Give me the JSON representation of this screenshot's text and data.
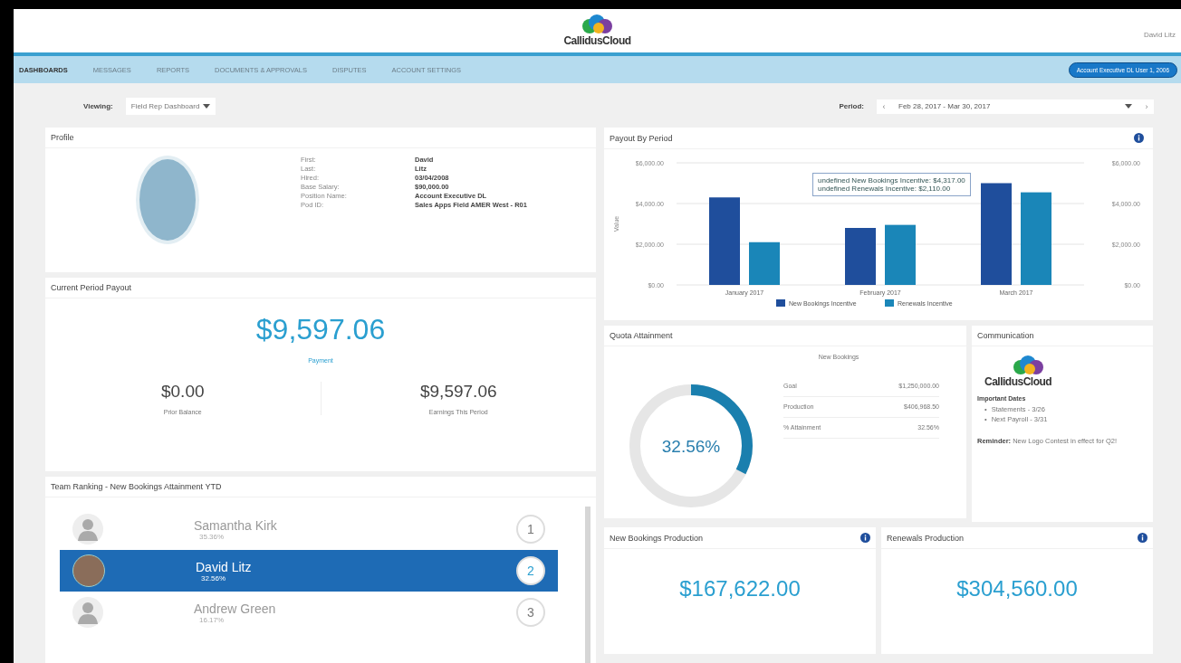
{
  "header": {
    "logo": "CallidusCloud",
    "user": "David Litz"
  },
  "nav": {
    "tabs": [
      {
        "label": "DASHBOARDS",
        "selected": true
      },
      {
        "label": "MESSAGES",
        "selected": false
      },
      {
        "label": "REPORTS",
        "selected": false
      },
      {
        "label": "DOCUMENTS & APPROVALS",
        "selected": false
      },
      {
        "label": "DISPUTES",
        "selected": false
      },
      {
        "label": "ACCOUNT SETTINGS",
        "selected": false
      }
    ],
    "badge": "Account Executive DL User 1, 2006"
  },
  "toolbar": {
    "viewing_label": "Viewing:",
    "viewing_value": "Field Rep Dashboard",
    "period_label": "Period:",
    "period_prev": "‹",
    "period_value": "Feb 28, 2017 - Mar 30, 2017",
    "period_next": "›"
  },
  "profile": {
    "title": "Profile",
    "fields": [
      {
        "label": "First:",
        "value": "David"
      },
      {
        "label": "Last:",
        "value": "Litz"
      },
      {
        "label": "Hired:",
        "value": "03/04/2008"
      },
      {
        "label": "Base Salary:",
        "value": "$90,000.00"
      },
      {
        "label": "Position Name:",
        "value": "Account Executive DL"
      },
      {
        "label": "Pod ID:",
        "value": "Sales Apps Field AMER West - R01"
      }
    ]
  },
  "current_payout": {
    "title": "Current Period Payout",
    "amount": "$9,597.06",
    "amount_label": "Payment",
    "items": [
      {
        "amount": "$0.00",
        "label": "Prior Balance"
      },
      {
        "amount": "$9,597.06",
        "label": "Earnings This Period"
      }
    ]
  },
  "team_ranking": {
    "title": "Team Ranking - New Bookings Attainment YTD",
    "rows": [
      {
        "name": "Samantha Kirk",
        "percent": "35.36%",
        "rank": "1",
        "selected": false,
        "kind": "generic"
      },
      {
        "name": "David Litz",
        "percent": "32.56%",
        "rank": "2",
        "selected": true,
        "kind": "photo"
      },
      {
        "name": "Andrew Green",
        "percent": "16.17%",
        "rank": "3",
        "selected": false,
        "kind": "generic"
      }
    ]
  },
  "payout_by_period": {
    "title": "Payout By Period",
    "right_ticks": [
      "$6,000.00",
      "$4,000.00",
      "$2,000.00",
      "$0.00"
    ],
    "tooltip": [
      "undefined New Bookings Incentive: $4,317.00",
      "undefined Renewals Incentive: $2,110.00"
    ],
    "chart_data": {
      "type": "bar",
      "ylabel": "Value",
      "categories": [
        "January 2017",
        "February 2017",
        "March 2017"
      ],
      "legend": "bottom",
      "series": [
        {
          "name": "New Bookings Incentive",
          "color": "#1f4e9c",
          "values": [
            4300,
            2800,
            5000
          ]
        },
        {
          "name": "Renewals Incentive",
          "color": "#1a86b8",
          "values": [
            2100,
            2950,
            4550
          ]
        }
      ],
      "ylim": [
        0,
        6000
      ],
      "yticks": [
        {
          "value": 0,
          "label": "$0.00"
        },
        {
          "value": 2000,
          "label": "$2,000.00"
        },
        {
          "value": 4000,
          "label": "$4,000.00"
        },
        {
          "value": 6000,
          "label": "$6,000.00"
        }
      ]
    }
  },
  "quota": {
    "title": "Quota Attainment",
    "subtitle": "New Bookings",
    "percent": "32.56%",
    "level": 0.3256,
    "rows": [
      {
        "label": "Goal",
        "value": "$1,250,000.00"
      },
      {
        "label": "Production",
        "value": "$406,968.50"
      },
      {
        "label": "% Attainment",
        "value": "32.56%"
      }
    ]
  },
  "communication": {
    "title": "Communication",
    "logo": "CallidusCloud",
    "dates_title": "Important Dates",
    "bullet": "•",
    "dates": [
      "Statements - 3/26",
      "Next Payroll - 3/31"
    ],
    "reminder_label": "Reminder:",
    "reminder": "New Logo Contest in effect for Q2!"
  },
  "production_cards": [
    {
      "title": "New Bookings Production",
      "amount": "$167,622.00"
    },
    {
      "title": "Renewals Production",
      "amount": "$304,560.00"
    }
  ]
}
